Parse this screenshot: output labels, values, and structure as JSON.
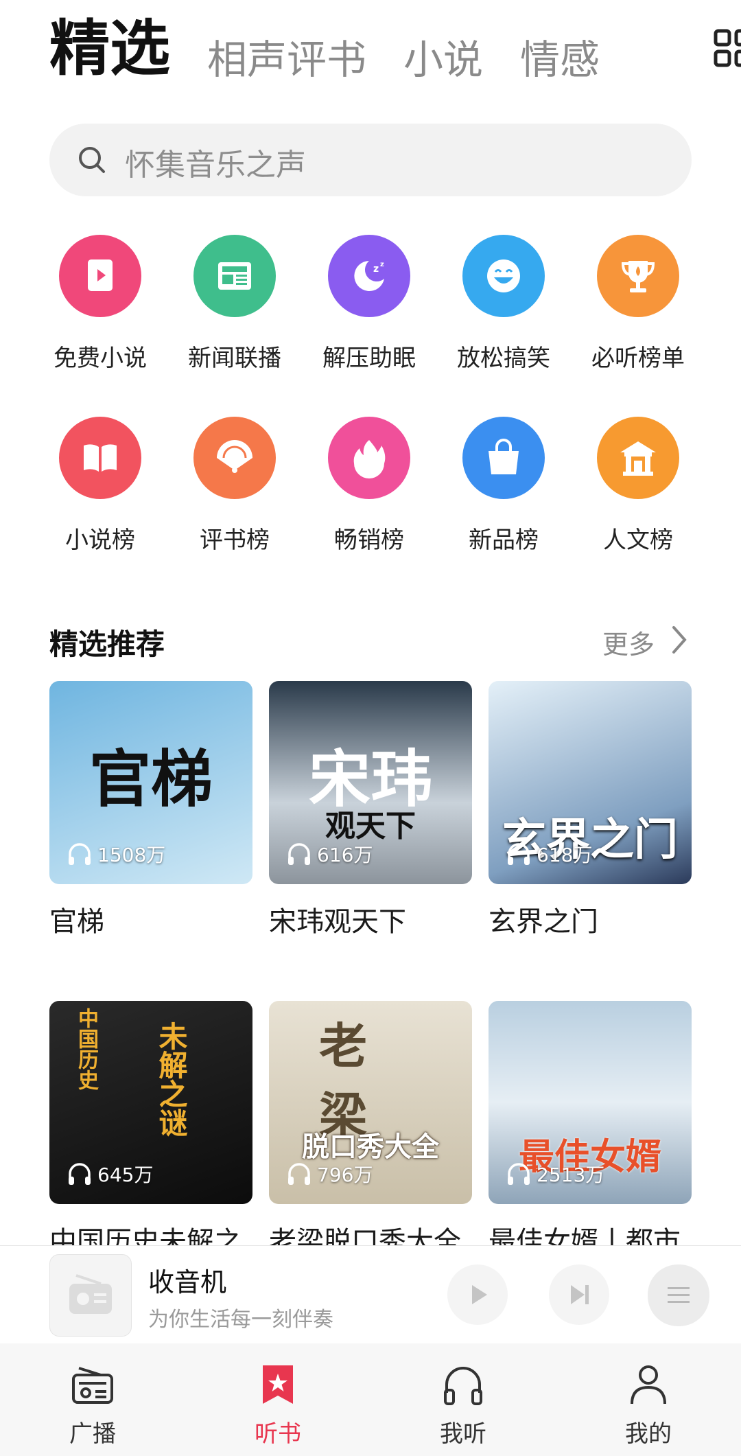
{
  "top_tabs": [
    {
      "label": "精选",
      "active": true
    },
    {
      "label": "相声评书",
      "active": false
    },
    {
      "label": "小说",
      "active": false
    },
    {
      "label": "情感",
      "active": false
    }
  ],
  "search": {
    "placeholder": "怀集音乐之声"
  },
  "categories_row1": [
    {
      "label": "免费小说",
      "icon": "video-book-icon",
      "color": "#f0487a"
    },
    {
      "label": "新闻联播",
      "icon": "news-icon",
      "color": "#3fbe8c"
    },
    {
      "label": "解压助眠",
      "icon": "moon-sleep-icon",
      "color": "#8a5cf0"
    },
    {
      "label": "放松搞笑",
      "icon": "laugh-face-icon",
      "color": "#36a9ef"
    },
    {
      "label": "必听榜单",
      "icon": "trophy-icon",
      "color": "#f7953a"
    }
  ],
  "categories_row2": [
    {
      "label": "小说榜",
      "icon": "open-book-icon",
      "color": "#f2535f"
    },
    {
      "label": "评书榜",
      "icon": "fan-icon",
      "color": "#f5784a"
    },
    {
      "label": "畅销榜",
      "icon": "flame-icon",
      "color": "#f0509a"
    },
    {
      "label": "新品榜",
      "icon": "shopping-bag-icon",
      "color": "#3b8ff0"
    },
    {
      "label": "人文榜",
      "icon": "pavilion-icon",
      "color": "#f79a30"
    }
  ],
  "section": {
    "title": "精选推荐",
    "more_label": "更多"
  },
  "cards": [
    {
      "name": "官梯",
      "plays": "1508万",
      "cover_title": "官梯",
      "cover_sub": "",
      "cover_bg": "#8ec6e6"
    },
    {
      "name": "宋玮观天下",
      "plays": "616万",
      "cover_title": "宋玮",
      "cover_sub": "观天下",
      "cover_bg": "#6f7b86"
    },
    {
      "name": "玄界之门",
      "plays": "618万",
      "cover_title": "玄界之门",
      "cover_sub": "",
      "cover_bg": "#c8dff0"
    },
    {
      "name": "中国历史未解之",
      "plays": "645万",
      "cover_title": "未解之谜",
      "cover_sub": "中国历史",
      "cover_bg": "#1c1c1c"
    },
    {
      "name": "老梁脱口秀大全",
      "plays": "796万",
      "cover_title": "老梁",
      "cover_sub": "脱口秀大全",
      "cover_bg": "#e6e0d2"
    },
    {
      "name": "最佳女婿丨都市",
      "plays": "2513万",
      "cover_title": "最佳女婿",
      "cover_sub": "",
      "cover_bg": "#9fb6c8"
    }
  ],
  "player": {
    "title": "收音机",
    "subtitle": "为你生活每一刻伴奏"
  },
  "bottom_nav": [
    {
      "label": "广播",
      "icon": "radio-icon",
      "active": false
    },
    {
      "label": "听书",
      "icon": "bookmark-star-icon",
      "active": true
    },
    {
      "label": "我听",
      "icon": "headphones-icon",
      "active": false
    },
    {
      "label": "我的",
      "icon": "person-icon",
      "active": false
    }
  ],
  "accent_color": "#e8364f"
}
